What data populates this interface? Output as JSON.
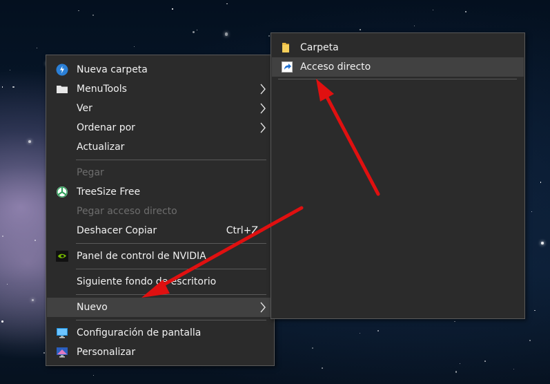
{
  "context_menu": {
    "items": [
      {
        "label": "Nueva carpeta",
        "icon": "new-folder-icon"
      },
      {
        "label": "MenuTools",
        "icon": "menutools-icon",
        "submenu": true
      },
      {
        "label": "Ver",
        "submenu": true
      },
      {
        "label": "Ordenar por",
        "submenu": true
      },
      {
        "label": "Actualizar"
      },
      {
        "label": "Pegar",
        "disabled": true
      },
      {
        "label": "TreeSize Free",
        "icon": "treesize-icon"
      },
      {
        "label": "Pegar acceso directo",
        "disabled": true
      },
      {
        "label": "Deshacer Copiar",
        "shortcut": "Ctrl+Z"
      },
      {
        "label": "Panel de control de NVIDIA",
        "icon": "nvidia-icon"
      },
      {
        "label": "Siguiente fondo de escritorio"
      },
      {
        "label": "Nuevo",
        "submenu": true,
        "highlighted": true
      },
      {
        "label": "Configuración de pantalla",
        "icon": "display-settings-icon"
      },
      {
        "label": "Personalizar",
        "icon": "personalize-icon"
      }
    ]
  },
  "new_submenu": {
    "items": [
      {
        "label": "Carpeta",
        "icon": "folder-icon"
      },
      {
        "label": "Acceso directo",
        "icon": "shortcut-icon",
        "highlighted": true
      }
    ]
  },
  "colors": {
    "menu_bg": "#2b2b2b",
    "hover_bg": "#414141",
    "text": "#f2f2f2",
    "disabled_text": "#6d6d6d",
    "annotation_arrow": "#e01010"
  }
}
